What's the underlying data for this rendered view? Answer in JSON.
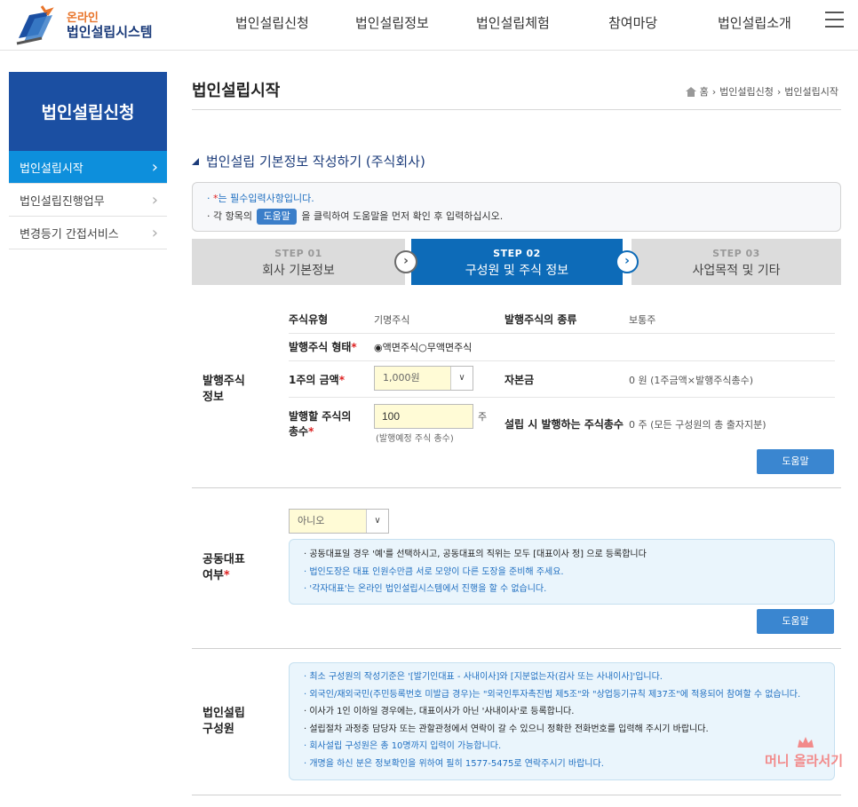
{
  "header": {
    "logo_sub": "온라인",
    "logo_main": "법인설립시스템",
    "nav": [
      "법인설립신청",
      "법인설립정보",
      "법인설립체험",
      "참여마당",
      "법인설립소개"
    ]
  },
  "sidebar": {
    "title": "법인설립신청",
    "items": [
      {
        "label": "법인설립시작",
        "active": true
      },
      {
        "label": "법인설립진행업무",
        "active": false
      },
      {
        "label": "변경등기 간접서비스",
        "active": false
      }
    ]
  },
  "page": {
    "title": "법인설립시작",
    "breadcrumb": [
      "홈",
      "법인설립신청",
      "법인설립시작"
    ]
  },
  "section": {
    "title": "법인설립 기본정보 작성하기 (주식회사)"
  },
  "notice": {
    "line1_star": "*",
    "line1_text": "는 필수입력사항입니다.",
    "line2_pre": "각 항목의",
    "line2_btn": "도움말",
    "line2_post": "을 클릭하여 도움말을 먼저 확인 후 입력하십시오."
  },
  "steps": [
    {
      "num": "STEP 01",
      "label": "회사 기본정보",
      "active": false
    },
    {
      "num": "STEP 02",
      "label": "구성원 및 주식 정보",
      "active": true
    },
    {
      "num": "STEP 03",
      "label": "사업목적 및 기타",
      "active": false
    }
  ],
  "stock": {
    "heading": "발행주식\n정보",
    "type_label": "주식유형",
    "type_value": "기명주식",
    "kind_label": "발행주식의 종류",
    "kind_value": "보통주",
    "form_label": "발행주식 형태",
    "form_options": [
      "액면주식",
      "무액면주식"
    ],
    "form_selected": "액면주식",
    "price_label": "1주의 금액",
    "price_value": "1,000원",
    "capital_label": "자본금",
    "capital_value": "0 원 (1주금액×발행주식총수)",
    "count_label_1": "발행할 주식의",
    "count_label_2": "총수",
    "count_value": "100",
    "count_unit": "주",
    "count_hint": "(발행예정 주식 총수)",
    "total_label": "설립 시 발행하는 주식총수",
    "total_value": "0 주 (모든 구성원의 총 출자지분)",
    "help": "도움말"
  },
  "joint_rep": {
    "heading_1": "공동대표",
    "heading_2": "여부",
    "select_value": "아니오",
    "notes": [
      "공동대표일 경우 '예'를 선택하시고, 공동대표의 직위는 모두 [대표이사 정] 으로 등록합니다",
      "법인도장은 대표 인원수만큼 서로 모양이 다른 도장을 준비해 주세요.",
      "'각자대표'는 온라인 법인설립시스템에서 진행을 할 수 없습니다."
    ],
    "help": "도움말"
  },
  "members": {
    "heading_1": "법인설립",
    "heading_2": "구성원",
    "notes": [
      "최소 구성원의 작성기준은 '[발기인대표 - 사내이사]와 [지분없는자(감사 또는 사내이사]'입니다.",
      "외국인/재외국민(주민등록번호 미발급 경우)는 \"외국인투자촉진법 제5조\"와 \"상업등기규칙 제37조\"에 적용되어 참여할 수 없습니다.",
      "이사가 1인 이하일 경우에는, 대표이사가 아닌 '사내이사'로 등록합니다.",
      "설립절차 과정중 담당자 또는 관할관청에서 연락이 갈 수 있으니 정확한 전화번호를 입력해 주시기 바랍니다.",
      "회사설립 구성원은 총 10명까지 입력이 가능합니다.",
      "개명을 하신 분은 정보확인을 위하여 필히 1577-5475로 연락주시기 바랍니다."
    ]
  },
  "watermark": "머니 올라서기",
  "colors": {
    "primary": "#1b4fa2",
    "active_side": "#0d8fdc",
    "step_active": "#0d6bb8",
    "required": "#dd2222",
    "help_button": "#3a86d0"
  }
}
